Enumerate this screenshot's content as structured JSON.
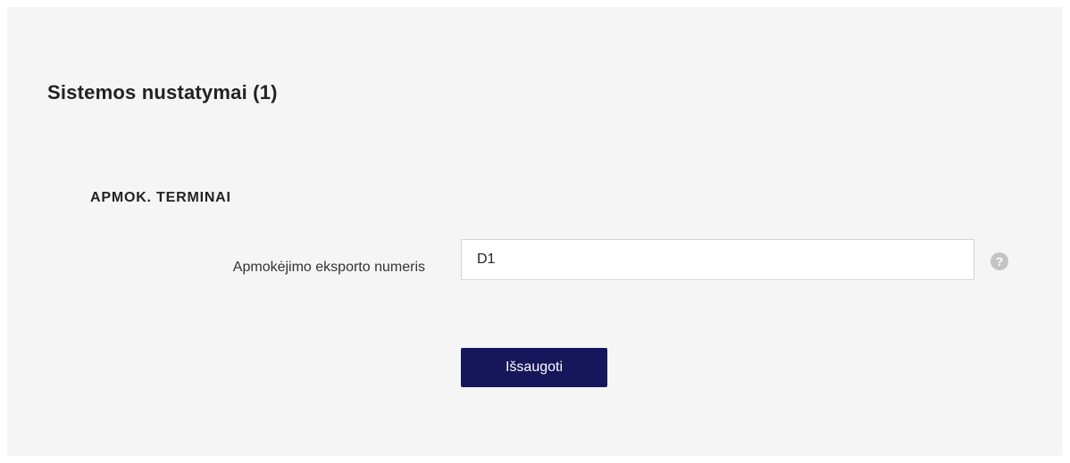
{
  "page": {
    "title": "Sistemos nustatymai (1)"
  },
  "section": {
    "title": "APMOK. TERMINAI"
  },
  "form": {
    "export_number": {
      "label": "Apmokėjimo eksporto numeris",
      "value": "D1",
      "help_icon": "question-circle-icon",
      "help_symbol": "?"
    },
    "save_button_label": "Išsaugoti"
  },
  "colors": {
    "button_background": "#16165b",
    "panel_background": "#f5f5f5",
    "help_icon": "#c4c4c4"
  }
}
